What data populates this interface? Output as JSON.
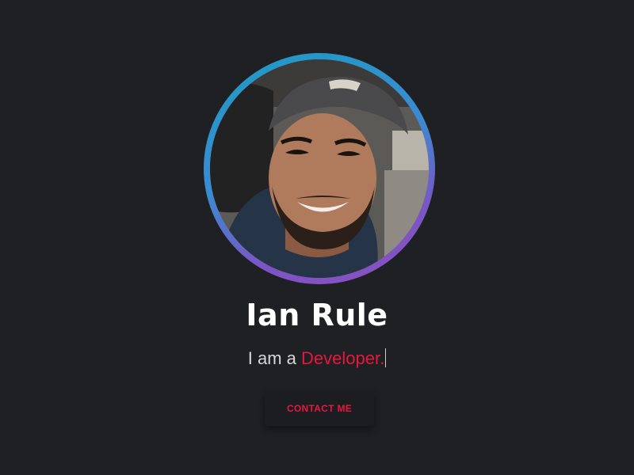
{
  "profile": {
    "name": "Ian Rule",
    "tagline_prefix": "I am a ",
    "tagline_role": "Developer."
  },
  "contact_button": {
    "label": "CONTACT ME"
  },
  "colors": {
    "background": "#1f2023",
    "accent": "#e8173f",
    "ring_start": "#1c9cc4",
    "ring_end": "#8e4fc0",
    "text": "#ffffff"
  },
  "avatar": {
    "icon": "profile-photo"
  }
}
